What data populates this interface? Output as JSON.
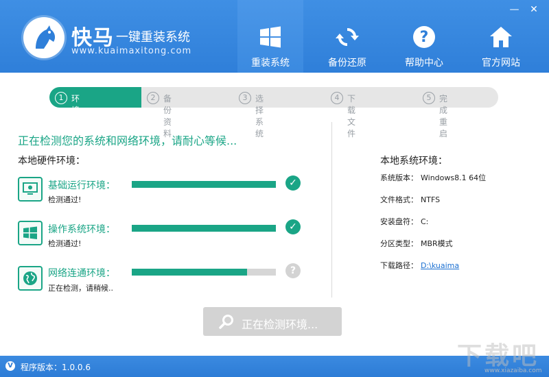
{
  "app": {
    "brand_title": "快马",
    "brand_tag": "一键重装系统",
    "brand_url": "www.kuaimaxitong.com",
    "accent_color": "#1aa586",
    "header_color": "#3a8ae0"
  },
  "window": {
    "minimize": "—",
    "close": "✕"
  },
  "nav": [
    {
      "label": "重装系统",
      "icon": "windows-logo-icon",
      "active": true
    },
    {
      "label": "备份还原",
      "icon": "sync-arrows-icon",
      "active": false
    },
    {
      "label": "帮助中心",
      "icon": "question-icon",
      "active": false
    },
    {
      "label": "官方网站",
      "icon": "home-icon",
      "active": false
    }
  ],
  "steps": [
    {
      "num": "1",
      "label": "环境检测",
      "active": true
    },
    {
      "num": "2",
      "label": "备份资料",
      "active": false
    },
    {
      "num": "3",
      "label": "选择系统",
      "active": false
    },
    {
      "num": "4",
      "label": "下载文件",
      "active": false
    },
    {
      "num": "5",
      "label": "完成重启",
      "active": false
    }
  ],
  "status_message": "正在检测您的系统和网络环境，请耐心等候...",
  "hardware": {
    "title": "本地硬件环境：",
    "checks": [
      {
        "label": "基础运行环境：",
        "state": "检测通过!",
        "progress": 1.0,
        "result": "✓",
        "result_icon": "check-icon"
      },
      {
        "label": "操作系统环境：",
        "state": "检测通过!",
        "progress": 1.0,
        "result": "✓",
        "result_icon": "check-icon"
      },
      {
        "label": "网络连通环境：",
        "state": "正在检测，请稍候..",
        "progress": 0.8,
        "result": "?",
        "result_icon": "question-icon"
      }
    ]
  },
  "system": {
    "title": "本地系统环境：",
    "rows": [
      {
        "key": "系统版本：",
        "value": "Windows8.1  64位"
      },
      {
        "key": "文件格式：",
        "value": "NTFS"
      },
      {
        "key": "安装盘符：",
        "value": "C:"
      },
      {
        "key": "分区类型：",
        "value": "MBR模式"
      },
      {
        "key": "下载路径：",
        "value": "D:\\kuaima"
      }
    ]
  },
  "detect_button": "正在检测环境...",
  "footer": {
    "badge": "V",
    "version_text": "程序版本：1.0.0.6"
  },
  "watermark": {
    "text": "下载吧",
    "url": "www.xiazaiba.com"
  }
}
